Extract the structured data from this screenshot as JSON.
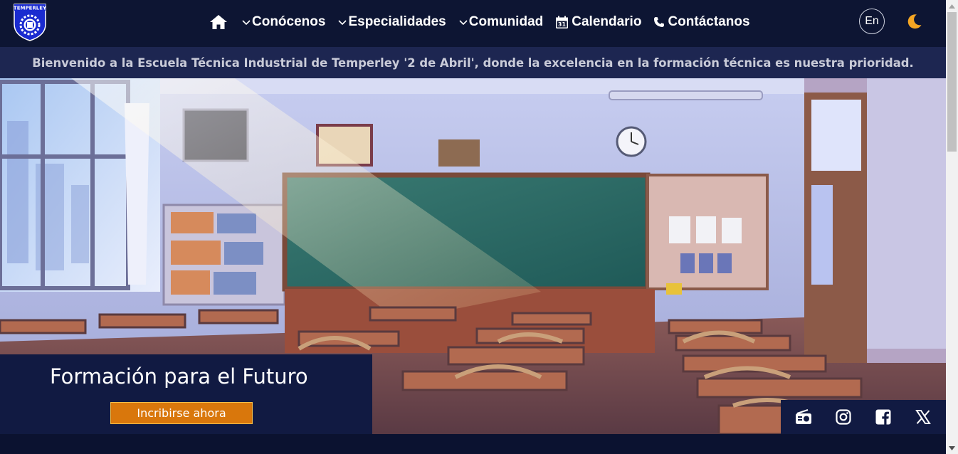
{
  "header": {
    "logo_text": "TEMPERLEY",
    "nav": [
      {
        "label": "Conócenos",
        "has_dropdown": true
      },
      {
        "label": "Especialidades",
        "has_dropdown": true
      },
      {
        "label": "Comunidad",
        "has_dropdown": true
      },
      {
        "label": "Calendario",
        "icon": "calendar-icon",
        "calendar_day": "31"
      },
      {
        "label": "Contáctanos",
        "icon": "phone-icon"
      }
    ],
    "language_button": "En",
    "theme_icon": "moon-icon"
  },
  "banner": {
    "text": "Bienvenido a la Escuela Técnica Industrial de Temperley '2 de Abril', donde la excelencia en la formación técnica es nuestra prioridad."
  },
  "hero": {
    "image": "classroom-illustration",
    "title": "Formación para el Futuro",
    "cta_label": "Incribirse ahora"
  },
  "social": [
    "radio-icon",
    "instagram-icon",
    "facebook-icon",
    "x-icon"
  ],
  "colors": {
    "header_bg": "#0d1533",
    "banner_bg": "#1d2651",
    "cta_bg": "#d9770c",
    "cta_border": "#f5c04a",
    "moon": "#f5a623",
    "box_bg": "#111a42"
  }
}
